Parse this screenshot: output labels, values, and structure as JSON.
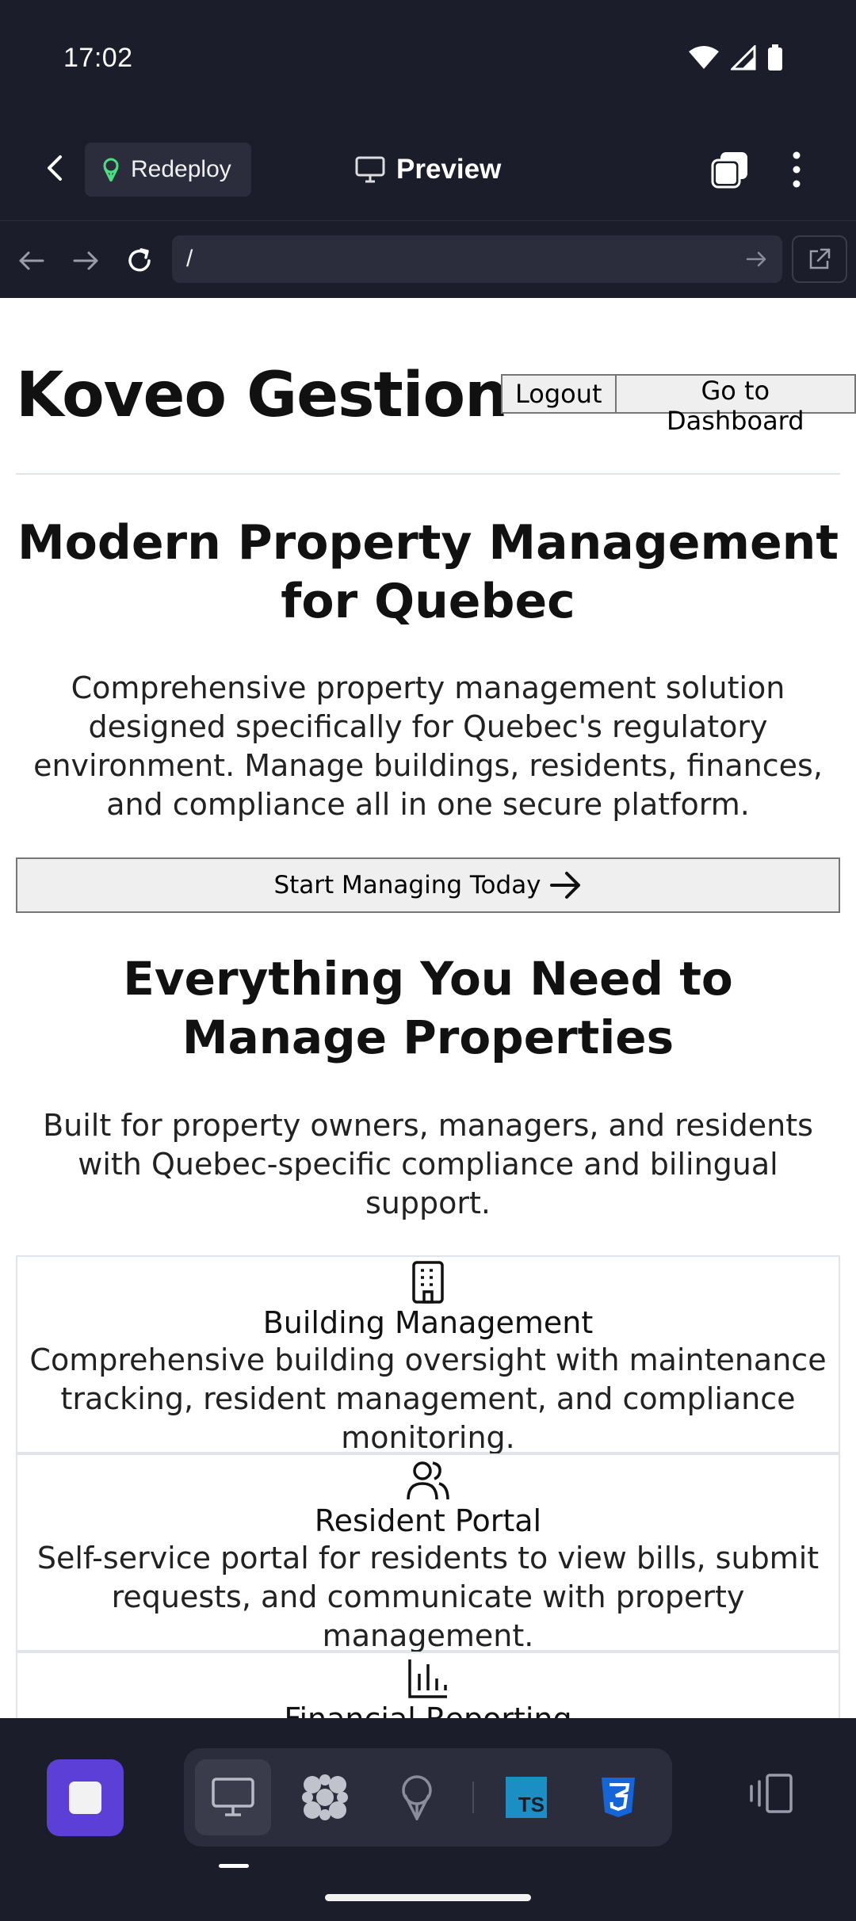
{
  "status_bar": {
    "time": "17:02"
  },
  "toolbar": {
    "redeploy_label": "Redeploy",
    "title": "Preview"
  },
  "url_bar": {
    "path": "/"
  },
  "site": {
    "brand": "Koveo Gestion",
    "logout_label": "Logout",
    "dashboard_label": "Go to Dashboard",
    "hero_title": "Modern Property Management for Quebec",
    "hero_text": "Comprehensive property management solution designed specifically for Quebec's regulatory environment. Manage buildings, residents, finances, and compliance all in one secure platform.",
    "cta_label": "Start Managing Today",
    "section_title": "Everything You Need to Manage Properties",
    "section_text": "Built for property owners, managers, and residents with Quebec-specific compliance and bilingual support.",
    "features": [
      {
        "icon": "building-icon",
        "title": "Building Management",
        "description": "Comprehensive building oversight with maintenance tracking, resident management, and compliance monitoring."
      },
      {
        "icon": "users-icon",
        "title": "Resident Portal",
        "description": "Self-service portal for residents to view bills, submit requests, and communicate with property management."
      },
      {
        "icon": "bar-chart-icon",
        "title": "Financial Reporting",
        "description": ""
      }
    ]
  },
  "dock": {
    "ts_label": "TS",
    "tools": [
      "monitor-icon",
      "grid-icon",
      "deploy-icon",
      "typescript-icon",
      "css3-icon"
    ]
  },
  "colors": {
    "chrome_bg": "#1c1d2a",
    "chrome_panel": "#2b2d3c",
    "accent_purple": "#5b3fd6",
    "ts_blue": "#1b8fc4",
    "css_blue": "#1565d8",
    "redeploy_green": "#4ade80"
  }
}
